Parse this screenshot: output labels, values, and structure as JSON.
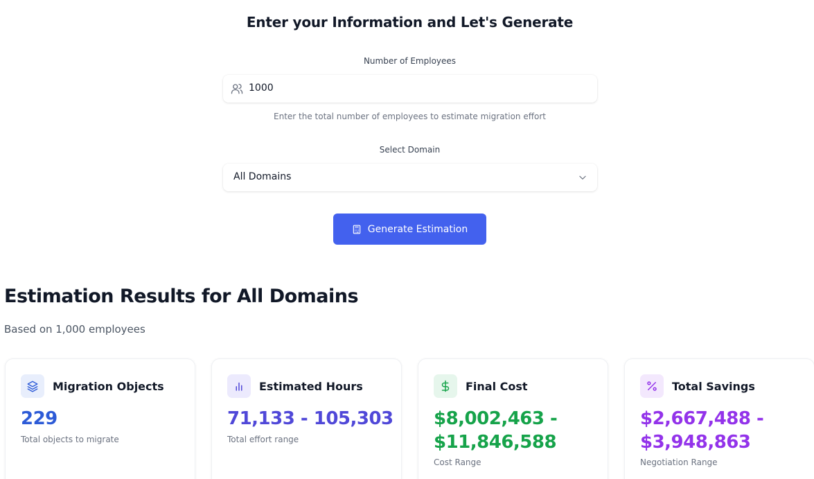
{
  "form": {
    "title": "Enter your Information and Let's Generate",
    "employees_label": "Number of Employees",
    "employees_value": "1000",
    "employees_helper": "Enter the total number of employees to estimate migration effort",
    "domain_label": "Select Domain",
    "domain_value": "All Domains",
    "generate_label": "Generate Estimation"
  },
  "results": {
    "title": "Estimation Results for All Domains",
    "subtitle": "Based on 1,000 employees",
    "cards": [
      {
        "title": "Migration Objects",
        "value": "229",
        "note": "Total objects to migrate",
        "icon": "layers-icon",
        "color": "#2d5bd7",
        "bg": "#e8eefc"
      },
      {
        "title": "Estimated Hours",
        "value": "71,133 - 105,303",
        "note": "Total effort range",
        "icon": "bar-chart-icon",
        "color": "#5048d8",
        "bg": "#eceafd"
      },
      {
        "title": "Final Cost",
        "value": "$8,002,463 - $11,846,588",
        "note": "Cost Range",
        "icon": "dollar-icon",
        "color": "#16a34a",
        "bg": "#e6f6ec"
      },
      {
        "title": "Total Savings",
        "value": "$2,667,488 - $3,948,863",
        "note": "Negotiation Range",
        "icon": "percent-icon",
        "color": "#9333ea",
        "bg": "#f3e8fd"
      }
    ]
  }
}
